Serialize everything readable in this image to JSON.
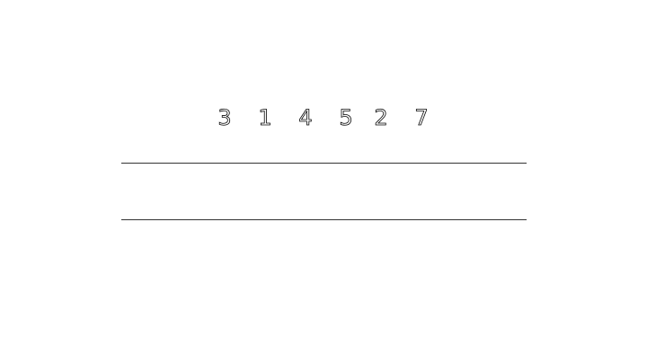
{
  "sequence": {
    "digits": [
      "3",
      "1",
      "4",
      "5",
      "2",
      "7"
    ]
  },
  "answer_area": {
    "value": ""
  },
  "colors": {
    "background": "#ffffff",
    "digit_outline": "#000000",
    "rule": "#333333"
  }
}
